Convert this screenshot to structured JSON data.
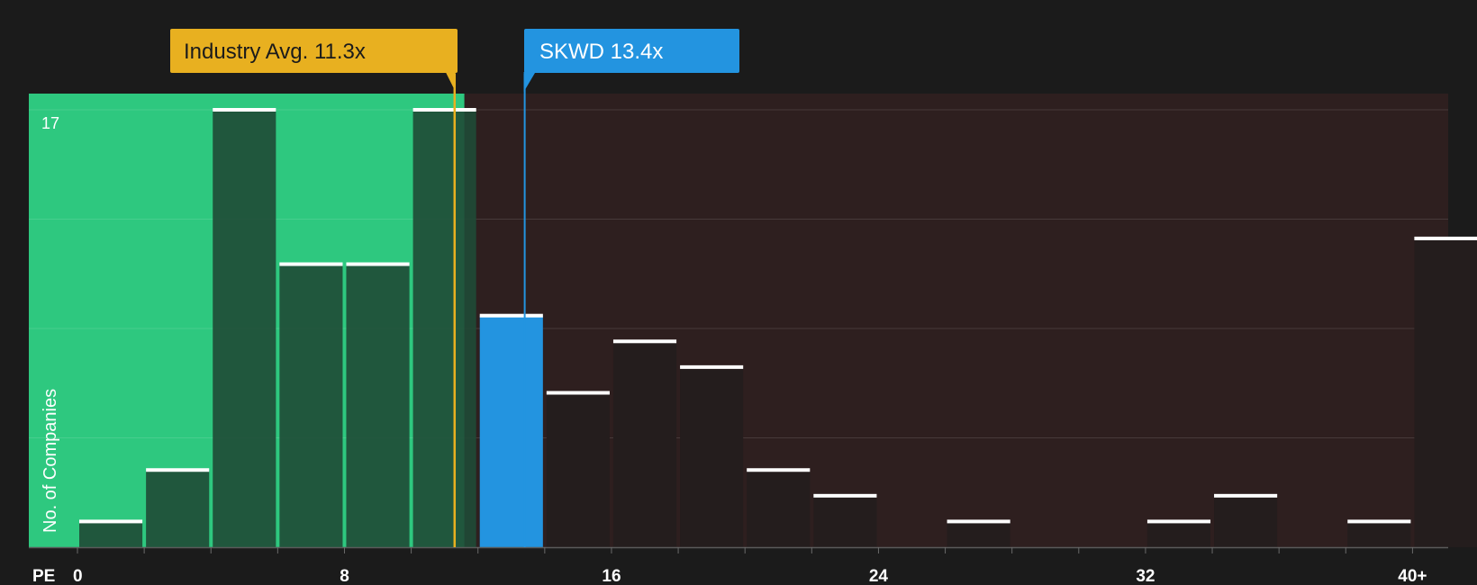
{
  "chart_data": {
    "type": "bar",
    "xlabel": "PE",
    "ylabel": "No. of Companies",
    "x_ticks": [
      "0",
      "8",
      "16",
      "24",
      "32",
      "40+"
    ],
    "y_tick_label": "17",
    "ylim": [
      0,
      17
    ],
    "bins": [
      {
        "x_start": 0,
        "x_end": 2,
        "count": 1
      },
      {
        "x_start": 2,
        "x_end": 4,
        "count": 3
      },
      {
        "x_start": 4,
        "x_end": 6,
        "count": 17
      },
      {
        "x_start": 6,
        "x_end": 8,
        "count": 11
      },
      {
        "x_start": 8,
        "x_end": 10,
        "count": 11
      },
      {
        "x_start": 10,
        "x_end": 12,
        "count": 17
      },
      {
        "x_start": 12,
        "x_end": 14,
        "count": 9
      },
      {
        "x_start": 14,
        "x_end": 16,
        "count": 6
      },
      {
        "x_start": 16,
        "x_end": 18,
        "count": 8
      },
      {
        "x_start": 18,
        "x_end": 20,
        "count": 7
      },
      {
        "x_start": 20,
        "x_end": 22,
        "count": 3
      },
      {
        "x_start": 22,
        "x_end": 24,
        "count": 2
      },
      {
        "x_start": 24,
        "x_end": 26,
        "count": 0
      },
      {
        "x_start": 26,
        "x_end": 28,
        "count": 1
      },
      {
        "x_start": 28,
        "x_end": 30,
        "count": 0
      },
      {
        "x_start": 30,
        "x_end": 32,
        "count": 0
      },
      {
        "x_start": 32,
        "x_end": 34,
        "count": 1
      },
      {
        "x_start": 34,
        "x_end": 36,
        "count": 2
      },
      {
        "x_start": 36,
        "x_end": 38,
        "count": 0
      },
      {
        "x_start": 38,
        "x_end": 40,
        "count": 1
      },
      {
        "x_start": 40,
        "x_end": 42,
        "count": 12
      }
    ],
    "highlight_bin_index": 6,
    "industry_avg": {
      "label": "Industry Avg. 11.3x",
      "value": 11.3
    },
    "company": {
      "label": "SKWD 13.4x",
      "ticker": "SKWD",
      "value": 13.4
    },
    "colors": {
      "background": "#1b1b1b",
      "undervalued_zone": "#2ec87f",
      "overvalued_zone": "#2e1f1f",
      "industry_avg": "#e8b020",
      "company": "#2394e0",
      "bar_in_zone": "#1f4a36",
      "bar_out_zone": "#241d1d",
      "bar_cap": "#ffffff",
      "text": "#ffffff"
    }
  }
}
